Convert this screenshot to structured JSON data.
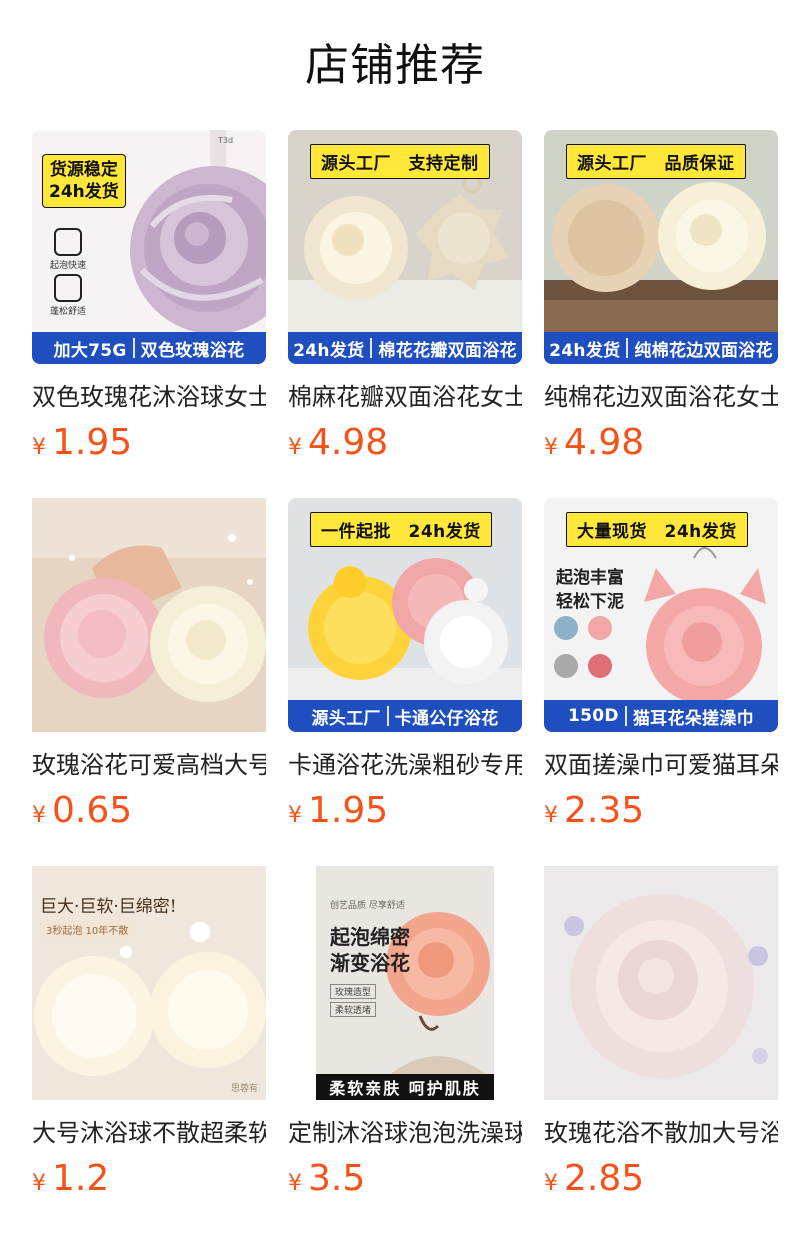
{
  "page_title": "店铺推荐",
  "currency": "¥",
  "products": [
    {
      "name": "双色玫瑰花沐浴球女士",
      "price": "1.95",
      "banner": [
        "加大75G",
        "双色玫瑰浴花"
      ],
      "badge_lines": [
        "货源稳定",
        "24h发货"
      ],
      "features": [
        "起泡快速",
        "蓬松舒适"
      ],
      "spine_text": "T3d"
    },
    {
      "name": "棉麻花瓣双面浴花女士",
      "price": "4.98",
      "banner": [
        "24h发货",
        "棉花花瓣双面浴花"
      ],
      "badge": "源头工厂　支持定制"
    },
    {
      "name": "纯棉花边双面浴花女士",
      "price": "4.98",
      "banner": [
        "24h发货",
        "纯棉花边双面浴花"
      ],
      "badge": "源头工厂　品质保证"
    },
    {
      "name": "玫瑰浴花可爱高档大号",
      "price": "0.65"
    },
    {
      "name": "卡通浴花洗澡粗砂专用",
      "price": "1.95",
      "banner": [
        "源头工厂",
        "卡通公仔浴花"
      ],
      "badge": "一件起批　24h发货"
    },
    {
      "name": "双面搓澡巾可爱猫耳朵",
      "price": "2.35",
      "banner": [
        "150D",
        "猫耳花朵搓澡巾"
      ],
      "badge": "大量现货　24h发货",
      "side_lines": [
        "起泡丰富",
        "轻松下泥"
      ]
    },
    {
      "name": "大号沐浴球不散超柔软",
      "price": "1.2",
      "overlay_title": "巨大·巨软·巨绵密!",
      "overlay_pill": "3秒起泡 10年不散",
      "watermark": "思蓉有"
    },
    {
      "name": "定制沐浴球泡泡洗澡球",
      "price": "3.5",
      "poster_top": "创艺品质 尽享舒适",
      "poster_lines": [
        "起泡绵密",
        "渐变浴花"
      ],
      "poster_tags": [
        "玫瑰造型",
        "柔软透堵"
      ],
      "poster_bottom": "柔软亲肤 呵护肌肤"
    },
    {
      "name": "玫瑰花浴不散加大号浴花",
      "price": "2.85"
    }
  ],
  "colors": {
    "price": "#f5521a",
    "banner": "#1f4fbf",
    "badge": "#ffe83a"
  }
}
